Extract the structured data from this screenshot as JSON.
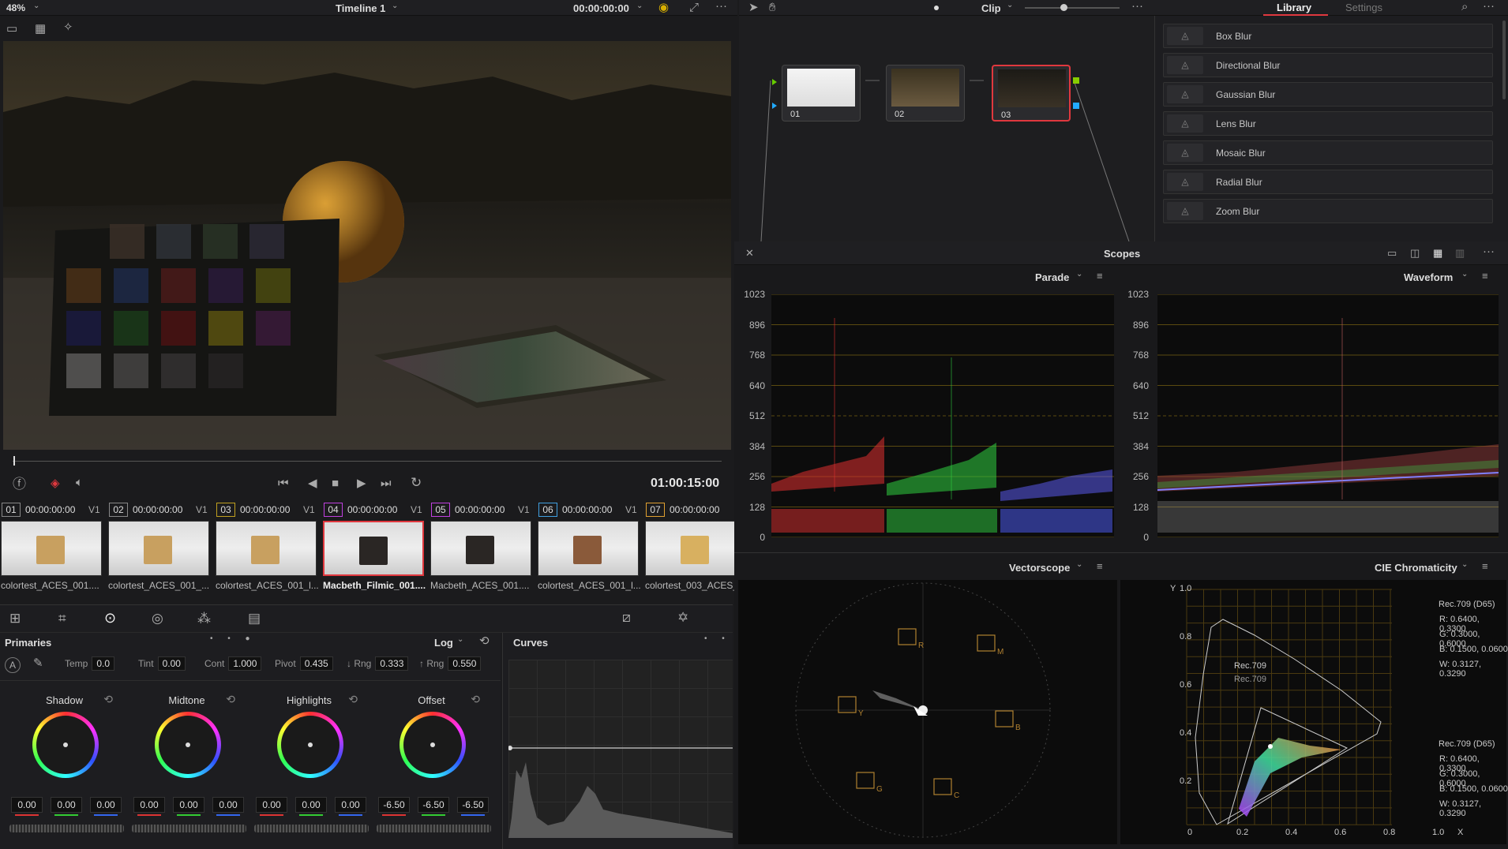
{
  "topbar": {
    "zoom": "48%",
    "timeline": "Timeline 1",
    "timecode": "00:00:00:00",
    "node_mode": "Clip",
    "tab_library": "Library",
    "tab_settings": "Settings"
  },
  "viewer": {
    "timecode": "01:00:15:00"
  },
  "library": {
    "items": [
      "Box Blur",
      "Directional Blur",
      "Gaussian Blur",
      "Lens Blur",
      "Mosaic Blur",
      "Radial Blur",
      "Zoom Blur"
    ]
  },
  "nodes": [
    {
      "label": "01"
    },
    {
      "label": "02"
    },
    {
      "label": "03"
    }
  ],
  "clips": [
    {
      "idx": "01",
      "tc": "00:00:00:00",
      "track": "V1",
      "name": "colortest_ACES_001....",
      "thumb": "#c8a060"
    },
    {
      "idx": "02",
      "tc": "00:00:00:00",
      "track": "V1",
      "name": "colortest_ACES_001_...",
      "thumb": "#c8a060"
    },
    {
      "idx": "03",
      "tc": "00:00:00:00",
      "track": "V1",
      "name": "colortest_ACES_001_l...",
      "thumb": "#c8a060"
    },
    {
      "idx": "04",
      "tc": "00:00:00:00",
      "track": "V1",
      "name": "Macbeth_Filmic_001....",
      "thumb": "#2a2624"
    },
    {
      "idx": "05",
      "tc": "00:00:00:00",
      "track": "V1",
      "name": "Macbeth_ACES_001....",
      "thumb": "#2a2624"
    },
    {
      "idx": "06",
      "tc": "00:00:00:00",
      "track": "V1",
      "name": "colortest_ACES_001_l...",
      "thumb": "#8a5a3a"
    },
    {
      "idx": "07",
      "tc": "00:00:00:00",
      "track": "",
      "name": "colortest_003_ACES_",
      "thumb": "#d8b060"
    }
  ],
  "primaries": {
    "title": "Primaries",
    "mode": "Log",
    "temp_label": "Temp",
    "temp": "0.0",
    "tint_label": "Tint",
    "tint": "0.00",
    "cont_label": "Cont",
    "cont": "1.000",
    "pivot_label": "Pivot",
    "pivot": "0.435",
    "lrng_label": "↓ Rng",
    "lrng": "0.333",
    "hrng_label": "↑ Rng",
    "hrng": "0.550",
    "wheels": [
      {
        "name": "Shadow",
        "vals": [
          "0.00",
          "0.00",
          "0.00"
        ]
      },
      {
        "name": "Midtone",
        "vals": [
          "0.00",
          "0.00",
          "0.00"
        ]
      },
      {
        "name": "Highlights",
        "vals": [
          "0.00",
          "0.00",
          "0.00"
        ]
      },
      {
        "name": "Offset",
        "vals": [
          "-6.50",
          "-6.50",
          "-6.50"
        ]
      }
    ]
  },
  "curves": {
    "title": "Curves"
  },
  "scopes": {
    "title": "Scopes",
    "parade": "Parade",
    "waveform": "Waveform",
    "vectorscope": "Vectorscope",
    "cie": "CIE Chromaticity",
    "ticks": [
      "1023",
      "896",
      "768",
      "640",
      "512",
      "384",
      "256",
      "128",
      "0"
    ],
    "cie_labels": {
      "y_axis": "Y",
      "x_axis": "X",
      "rec_top": "Rec.709 (D65)",
      "rec_bot": "Rec.709 (D65)",
      "r": "R: 0.6400, 0.3300",
      "g": "G: 0.3000, 0.6000",
      "b": "B: 0.1500, 0.0600",
      "w": "W: 0.3127, 0.3290",
      "tri_a": "Rec.709",
      "tri_b": "Rec.709"
    },
    "cie_x": [
      "0",
      "0.2",
      "0.4",
      "0.6",
      "0.8",
      "1.0"
    ],
    "cie_y": [
      "1.0",
      "0.8",
      "0.6",
      "0.4",
      "0.2"
    ]
  },
  "colors": {
    "accent": "#e0383e",
    "bg": "#1b1b1d"
  }
}
